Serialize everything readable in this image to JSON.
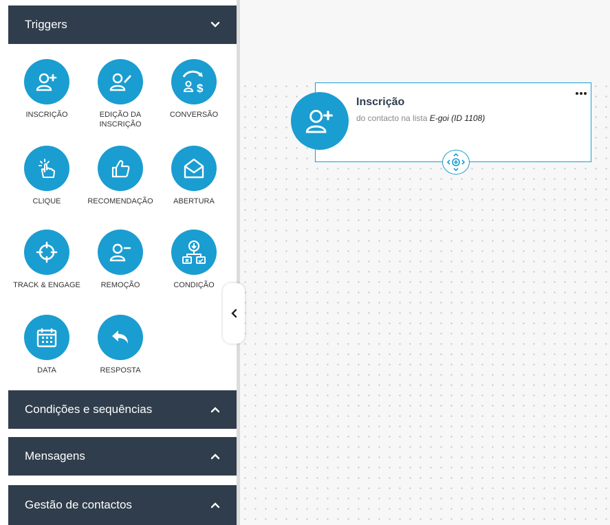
{
  "sidebar": {
    "panels": [
      {
        "label": "Triggers",
        "state": "expanded"
      },
      {
        "label": "Condições e sequências",
        "state": "collapsed"
      },
      {
        "label": "Mensagens",
        "state": "collapsed"
      },
      {
        "label": "Gestão de contactos",
        "state": "collapsed"
      }
    ],
    "triggers": [
      {
        "label": "INSCRIÇÃO",
        "icon": "user-add-icon"
      },
      {
        "label": "EDIÇÃO DA INSCRIÇÃO",
        "icon": "user-edit-icon"
      },
      {
        "label": "CONVERSÃO",
        "icon": "conversion-icon"
      },
      {
        "label": "CLIQUE",
        "icon": "click-icon"
      },
      {
        "label": "RECOMENDAÇÃO",
        "icon": "thumbs-up-icon"
      },
      {
        "label": "ABERTURA",
        "icon": "envelope-open-icon"
      },
      {
        "label": "TRACK & ENGAGE",
        "icon": "crosshair-icon"
      },
      {
        "label": "REMOÇÃO",
        "icon": "user-remove-icon"
      },
      {
        "label": "CONDIÇÃO",
        "icon": "condition-icon"
      },
      {
        "label": "DATA",
        "icon": "calendar-icon"
      },
      {
        "label": "RESPOSTA",
        "icon": "reply-icon"
      }
    ]
  },
  "canvas": {
    "node": {
      "title": "Inscrição",
      "description_prefix": "do contacto na lista ",
      "list_name": "E-goi (ID 1108)",
      "icon": "user-add-icon"
    }
  },
  "colors": {
    "accent": "#1a9dd1",
    "header_bg": "#2f3d4c",
    "canvas_bg": "#f7f7f7"
  }
}
